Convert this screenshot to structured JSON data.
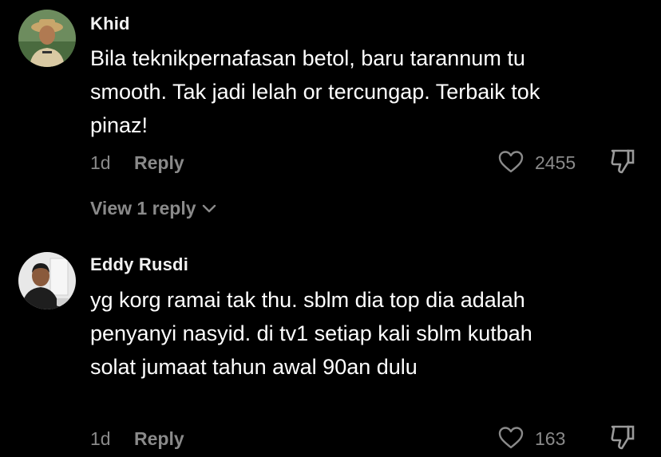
{
  "comments": [
    {
      "username": "Khid",
      "text": "Bila teknikpernafasan betol, baru tarannum tu smooth. Tak jadi lelah or tercungap. Terbaik tok pinaz!",
      "time": "1d",
      "reply_label": "Reply",
      "likes": "2455",
      "view_replies": "View 1 reply"
    },
    {
      "username": "Eddy Rusdi",
      "text": "yg korg ramai tak thu. sblm dia top dia adalah penyanyi nasyid. di tv1 setiap kali sblm kutbah solat jumaat tahun awal 90an dulu",
      "time": "1d",
      "reply_label": "Reply",
      "likes": "163"
    }
  ],
  "colors": {
    "background": "#000000",
    "text": "#ffffff",
    "muted": "#8a8a8a"
  }
}
